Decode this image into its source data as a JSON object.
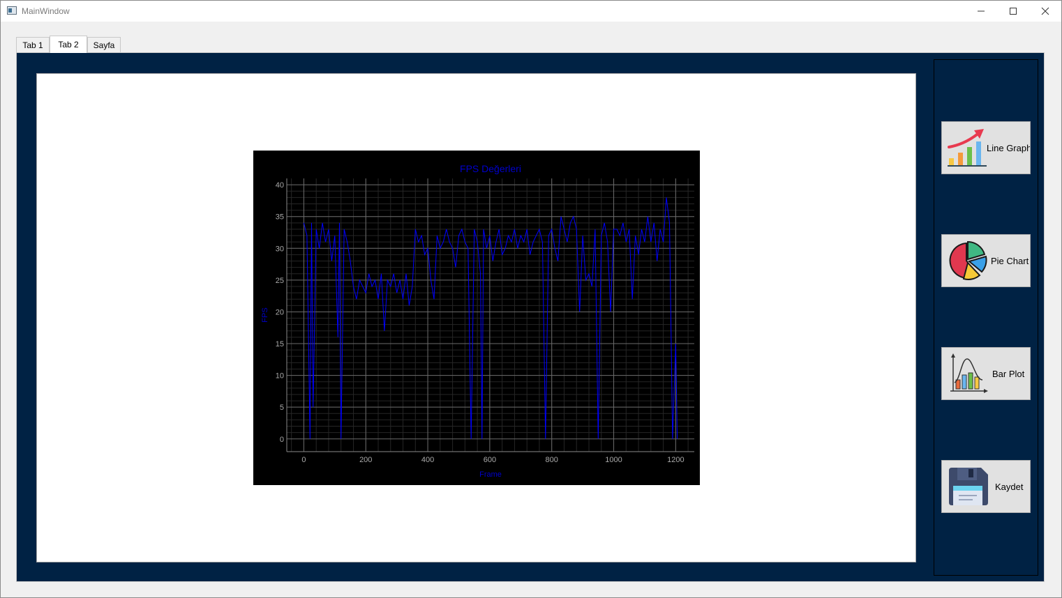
{
  "window": {
    "title": "MainWindow"
  },
  "tabs": [
    {
      "label": "Tab 1",
      "active": false
    },
    {
      "label": "Tab 2",
      "active": true
    },
    {
      "label": "Sayfa",
      "active": false
    }
  ],
  "sidebar": {
    "buttons": [
      {
        "label": "Line Graph",
        "icon": "line-graph-icon"
      },
      {
        "label": "Pie Chart",
        "icon": "pie-chart-icon"
      },
      {
        "label": "Bar Plot",
        "icon": "bar-plot-icon"
      },
      {
        "label": "Kaydet",
        "icon": "floppy-disk-icon"
      }
    ]
  },
  "colors": {
    "panel_bg": "#002244",
    "chart_bg": "#000000",
    "series": "#0000ff",
    "title_text": "#0000cc",
    "tick_text": "#aaaaaa"
  },
  "chart_data": {
    "type": "line",
    "title": "FPS Değerleri",
    "xlabel": "Frame",
    "ylabel": "FPS",
    "xlim": [
      -55,
      1260
    ],
    "ylim": [
      -2,
      41
    ],
    "xticks": [
      0,
      200,
      400,
      600,
      800,
      1000,
      1200
    ],
    "yticks": [
      0,
      5,
      10,
      15,
      20,
      25,
      30,
      35,
      40
    ],
    "grid": true,
    "series": [
      {
        "x": [
          0,
          10,
          20,
          25,
          30,
          40,
          50,
          60,
          70,
          80,
          90,
          100,
          110,
          115,
          120,
          130,
          140,
          150,
          160,
          170,
          180,
          190,
          200,
          210,
          220,
          230,
          240,
          250,
          260,
          270,
          280,
          290,
          300,
          310,
          320,
          330,
          340,
          350,
          360,
          370,
          380,
          390,
          400,
          410,
          420,
          430,
          440,
          450,
          460,
          470,
          480,
          490,
          500,
          510,
          520,
          530,
          540,
          550,
          560,
          570,
          575,
          580,
          590,
          600,
          610,
          620,
          630,
          640,
          650,
          660,
          670,
          680,
          690,
          700,
          710,
          720,
          730,
          740,
          750,
          760,
          770,
          780,
          790,
          800,
          810,
          820,
          830,
          840,
          850,
          860,
          870,
          880,
          890,
          900,
          910,
          920,
          930,
          940,
          950,
          960,
          970,
          980,
          990,
          1000,
          1010,
          1020,
          1030,
          1040,
          1050,
          1060,
          1070,
          1080,
          1090,
          1100,
          1110,
          1120,
          1130,
          1140,
          1150,
          1160,
          1170,
          1180,
          1190,
          1200,
          1205
        ],
        "values": [
          34,
          32,
          0,
          34,
          5,
          33,
          30,
          34,
          31,
          33,
          28,
          32,
          16,
          34,
          0,
          33,
          31,
          28,
          24,
          22,
          25,
          24,
          23,
          26,
          24,
          25,
          22,
          26,
          17,
          25,
          24,
          26,
          23,
          25,
          22,
          26,
          21,
          24,
          33,
          31,
          32,
          29,
          30,
          25,
          22,
          32,
          30,
          31,
          33,
          31,
          30,
          27,
          32,
          33,
          31,
          30,
          0,
          33,
          31,
          26,
          0,
          33,
          30,
          32,
          28,
          31,
          33,
          29,
          30,
          32,
          31,
          33,
          30,
          32,
          31,
          33,
          29,
          31,
          32,
          33,
          31,
          0,
          32,
          33,
          30,
          28,
          35,
          33,
          31,
          34,
          35,
          33,
          20,
          32,
          25,
          26,
          24,
          33,
          0,
          32,
          34,
          31,
          20,
          33,
          33,
          32,
          34,
          31,
          33,
          22,
          32,
          29,
          33,
          31,
          35,
          31,
          34,
          28,
          33,
          31,
          38,
          34,
          0,
          15,
          0
        ]
      }
    ]
  }
}
